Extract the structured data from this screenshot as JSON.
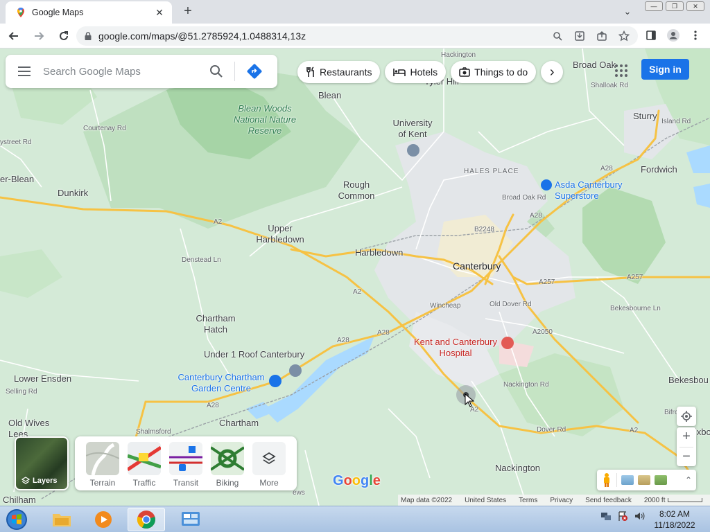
{
  "browser": {
    "tab_title": "Google Maps",
    "tab_close": "✕",
    "new_tab": "+",
    "tab_search": "⌄",
    "url": "google.com/maps/@51.2785924,1.0488314,13z",
    "window_buttons": [
      "—",
      "❐",
      "✕"
    ]
  },
  "search": {
    "placeholder": "Search Google Maps"
  },
  "chips": [
    {
      "label": "Restaurants",
      "icon": "fork-knife-icon"
    },
    {
      "label": "Hotels",
      "icon": "bed-icon"
    },
    {
      "label": "Things to do",
      "icon": "camera-icon"
    }
  ],
  "chip_next": "›",
  "sign_in": "Sign in",
  "map_labels": {
    "broad_oak": "Broad Oak",
    "blean": "Blean",
    "tyler_hill": "Tyler Hill",
    "university_kent": "University of Kent",
    "blean_woods": "Blean Woods National Nature Reserve",
    "sturry": "Sturry",
    "fordwich": "Fordwich",
    "hales_place": "HALES PLACE",
    "asda": "Asda Canterbury Superstore",
    "dunkirk": "Dunkirk",
    "er_blean": "er-Blean",
    "rough_common": "Rough Common",
    "upper_harbledown": "Upper Harbledown",
    "harbledown": "Harbledown",
    "canterbury": "Canterbury",
    "chartham_hatch": "Chartham Hatch",
    "kent_hospital": "Kent and Canterbury Hospital",
    "under1roof": "Under 1 Roof Canterbury",
    "garden_centre": "Canterbury Chartham Garden Centre",
    "lower_ensden": "Lower Ensden",
    "old_wives": "Old Wives Lees",
    "chartham": "Chartham",
    "nackington": "Nackington",
    "bekesbourne": "Bekesbou",
    "patrixbourne": "Patrixbo",
    "chilham": "Chilham"
  },
  "road_labels": {
    "a2_1": "A2",
    "a2_2": "A2",
    "a2_3": "A2",
    "a2_4": "A2",
    "a28_1": "A28",
    "a28_2": "A28",
    "a28_3": "A28",
    "a28_4": "A28",
    "a28_5": "A28",
    "a257_1": "A257",
    "a257_2": "A257",
    "a2050": "A2050",
    "b2248": "B2248",
    "wincheap": "Wincheap",
    "old_dover": "Old Dover Rd",
    "dover_rd": "Dover Rd",
    "nackington_rd": "Nackington Rd",
    "broad_oak_rd": "Broad Oak Rd",
    "island_rd": "Island Rd",
    "shalloak_rd": "Shalloak Rd",
    "bekesbourne_ln": "Bekesbourne Ln",
    "denstead_ln": "Denstead Ln",
    "courtenay_rd": "Courtenay Rd",
    "selling_rd": "Selling Rd",
    "hackington": "Hackington",
    "stream_rd": "ystreet Rd",
    "shalmsford": "Shalmsford",
    "ews": "ews",
    "bifrons": "Bifrons"
  },
  "layers": {
    "button_label": "Layers",
    "items": [
      {
        "label": "Terrain"
      },
      {
        "label": "Traffic"
      },
      {
        "label": "Transit"
      },
      {
        "label": "Biking"
      },
      {
        "label": "More"
      }
    ]
  },
  "zoom": {
    "in": "+",
    "out": "−"
  },
  "expand_icon": "⌃",
  "google_logo": [
    "G",
    "o",
    "o",
    "g",
    "l",
    "e"
  ],
  "logo_colors": [
    "#4285f4",
    "#ea4335",
    "#fbbc05",
    "#4285f4",
    "#34a853",
    "#ea4335"
  ],
  "footer": {
    "map_data": "Map data ©2022",
    "country": "United States",
    "terms": "Terms",
    "privacy": "Privacy",
    "feedback": "Send feedback",
    "scale": "2000 ft"
  },
  "taskbar": {
    "time": "8:02 AM",
    "date": "11/18/2022"
  },
  "colors": {
    "accent": "#1a73e8",
    "motorway": "#f6c244",
    "urban": "#e8eaed",
    "water": "#aadaff",
    "forest": "#a8d5a2",
    "poi_red": "#c5221f"
  }
}
